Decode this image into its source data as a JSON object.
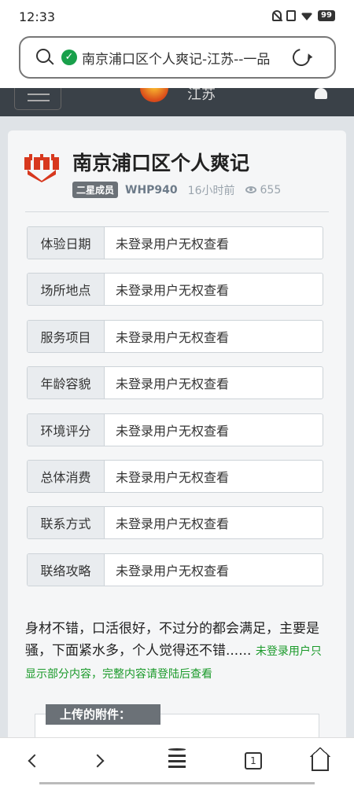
{
  "status_bar": {
    "time": "12:33",
    "battery": "99"
  },
  "browser": {
    "url": "南京浦口区个人爽记-江苏--一品",
    "search_icon": "search-icon",
    "secure_icon": "shield-check-icon",
    "reload_icon": "reload-icon"
  },
  "site_header": {
    "city": "江苏"
  },
  "post": {
    "title": "南京浦口区个人爽记",
    "rank": "二星成员",
    "author": "WHP940",
    "time": "16小时前",
    "views": "655",
    "info": [
      {
        "label": "体验日期",
        "value": "未登录用户无权查看"
      },
      {
        "label": "场所地点",
        "value": "未登录用户无权查看"
      },
      {
        "label": "服务项目",
        "value": "未登录用户无权查看"
      },
      {
        "label": "年龄容貌",
        "value": "未登录用户无权查看"
      },
      {
        "label": "环境评分",
        "value": "未登录用户无权查看"
      },
      {
        "label": "总体消费",
        "value": "未登录用户无权查看"
      },
      {
        "label": "联系方式",
        "value": "未登录用户无权查看"
      },
      {
        "label": "联络攻略",
        "value": "未登录用户无权查看"
      }
    ],
    "description": "身材不错，口活很好，不过分的都会满足，主要是骚，下面紧水多，个人觉得还不错......",
    "login_notice": "未登录用户只显示部分内容，完整内容请登陆后查看",
    "attachments_label": "上传的附件："
  },
  "bottom_nav": {
    "tab_count": "1"
  },
  "colors": {
    "accent_green": "#1a9a2a",
    "header_dark": "#3a4148",
    "badge_gray": "#6b7177"
  }
}
